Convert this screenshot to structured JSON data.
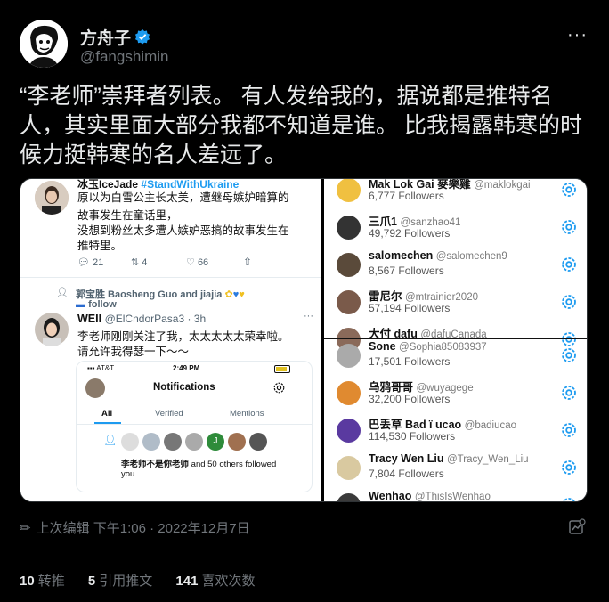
{
  "author": {
    "name": "方舟子",
    "handle": "@fangshimin"
  },
  "tweet_text": "“李老师”崇拜者列表。 有人发给我的，据说都是推特名人，其实里面大部分我都不知道是谁。 比我揭露韩寒的时候力挺韩寒的名人差远了。",
  "left_shot": {
    "top_post": {
      "name": "冰玉IceJade",
      "hashtag": "#StandWithUkraine",
      "lines": [
        "原以为白雪公主长太美，遭继母嫉妒暗算的",
        "故事发生在童话里，",
        "没想到粉丝太多遭人嫉妒恶搞的故事发生在",
        "推特里。"
      ],
      "replies": "21",
      "retweets": "4",
      "likes": "66"
    },
    "reply_by": "郭宝胜 Baosheng Guo and jiajia",
    "follow_label": "follow",
    "second_post": {
      "name": "WEII",
      "handle": "@ElCndorPasa3 · 3h",
      "lines": [
        "李老师刚刚关注了我，太太太太太荣幸啦。",
        "请允许我得瑟一下～～"
      ]
    },
    "phone": {
      "carrier": "AT&T",
      "time": "2:49 PM",
      "title": "Notifications",
      "tabs": [
        "All",
        "Verified",
        "Mentions"
      ],
      "notice": "李老师不是你老师",
      "notice_rest": " and 50 others followed",
      "notice_line2": "you"
    }
  },
  "right_shot": {
    "rows": [
      {
        "name": "Mak Lok Gai 麥樂雞",
        "handle": "@maklokgai",
        "followers": "6,777 Followers",
        "color": "#f0c040"
      },
      {
        "name": "三爪1",
        "handle": "@sanzhao41",
        "followers": "49,792 Followers",
        "color": "#333"
      },
      {
        "name": "salomechen",
        "handle": "@salomechen9",
        "followers": "8,567 Followers",
        "color": "#5a4a3a"
      },
      {
        "name": "雷尼尔",
        "handle": "@mtrainier2020",
        "followers": "57,194 Followers",
        "color": "#7a5a4a"
      },
      {
        "name": "大付 dafu",
        "handle": "@dafuCanada",
        "followers": "",
        "color": "#8a6a5a"
      },
      {
        "name": "Sone",
        "handle": "@Sophia85083937",
        "followers": "17,501 Followers",
        "color": "#aaa"
      },
      {
        "name": "乌鸦哥哥",
        "handle": "@wuyagege",
        "followers": "32,200 Followers",
        "color": "#e08a30"
      },
      {
        "name": "巴丢草 Bad ï ucao",
        "handle": "@badiucao",
        "followers": "114,530 Followers",
        "color": "#5a3aa0"
      },
      {
        "name": "Tracy Wen Liu",
        "handle": "@Tracy_Wen_Liu",
        "followers": "7,804 Followers",
        "color": "#d9c9a0"
      },
      {
        "name": "Wenhao",
        "handle": "@ThisIsWenhao",
        "followers": "",
        "color": "#3a3a3a"
      }
    ]
  },
  "meta": {
    "edit": "上次编辑 下午1:06 · 2022年12月7日"
  },
  "stats": [
    {
      "count": "10",
      "label": "转推"
    },
    {
      "count": "5",
      "label": "引用推文"
    },
    {
      "count": "141",
      "label": "喜欢次数"
    }
  ],
  "colors": {
    "bg": "#000000",
    "text": "#e7e9ea",
    "muted": "#71767b",
    "accent": "#1d9bf0"
  }
}
